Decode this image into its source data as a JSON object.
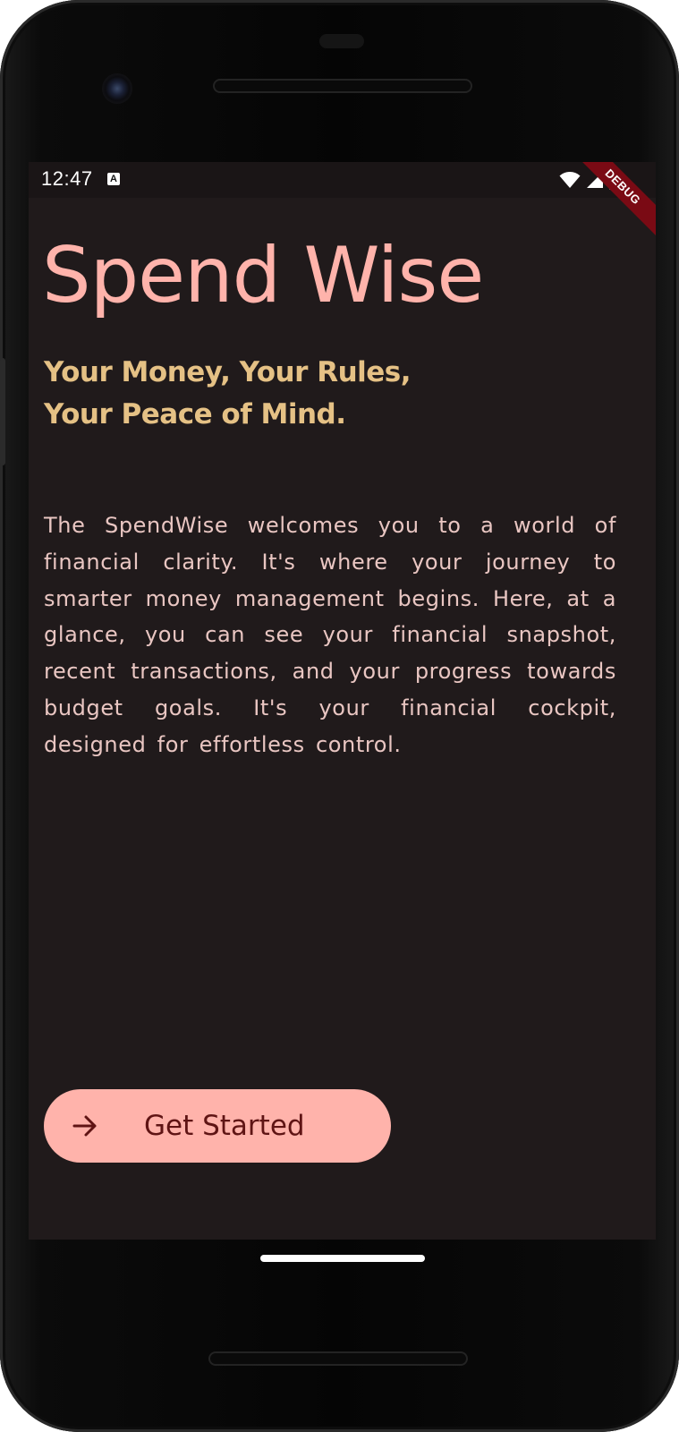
{
  "status_bar": {
    "time": "12:47",
    "notification_icon": "a-icon",
    "debug_label": "DEBUG",
    "icons": [
      "wifi-icon",
      "signal-icon",
      "battery-icon"
    ]
  },
  "app": {
    "title": "Spend Wise",
    "tagline_line1": "Your Money, Your Rules,",
    "tagline_line2": "Your Peace of Mind.",
    "intro": "The SpendWise welcomes you to a world of financial clarity. It's where your journey to smarter money management begins. Here, at a glance, you can see your financial snapshot, recent transactions, and your progress towards budget goals. It's your financial cockpit, designed for effortless control.",
    "cta_label": "Get Started",
    "cta_icon": "arrow-right-icon"
  },
  "colors": {
    "background": "#201a1b",
    "title": "#ffb3ab",
    "tagline": "#e5c185",
    "body_text": "#e9c6c2",
    "button_bg": "#ffb3ab",
    "button_text": "#5f1414",
    "debug_banner": "#7a0a14"
  }
}
